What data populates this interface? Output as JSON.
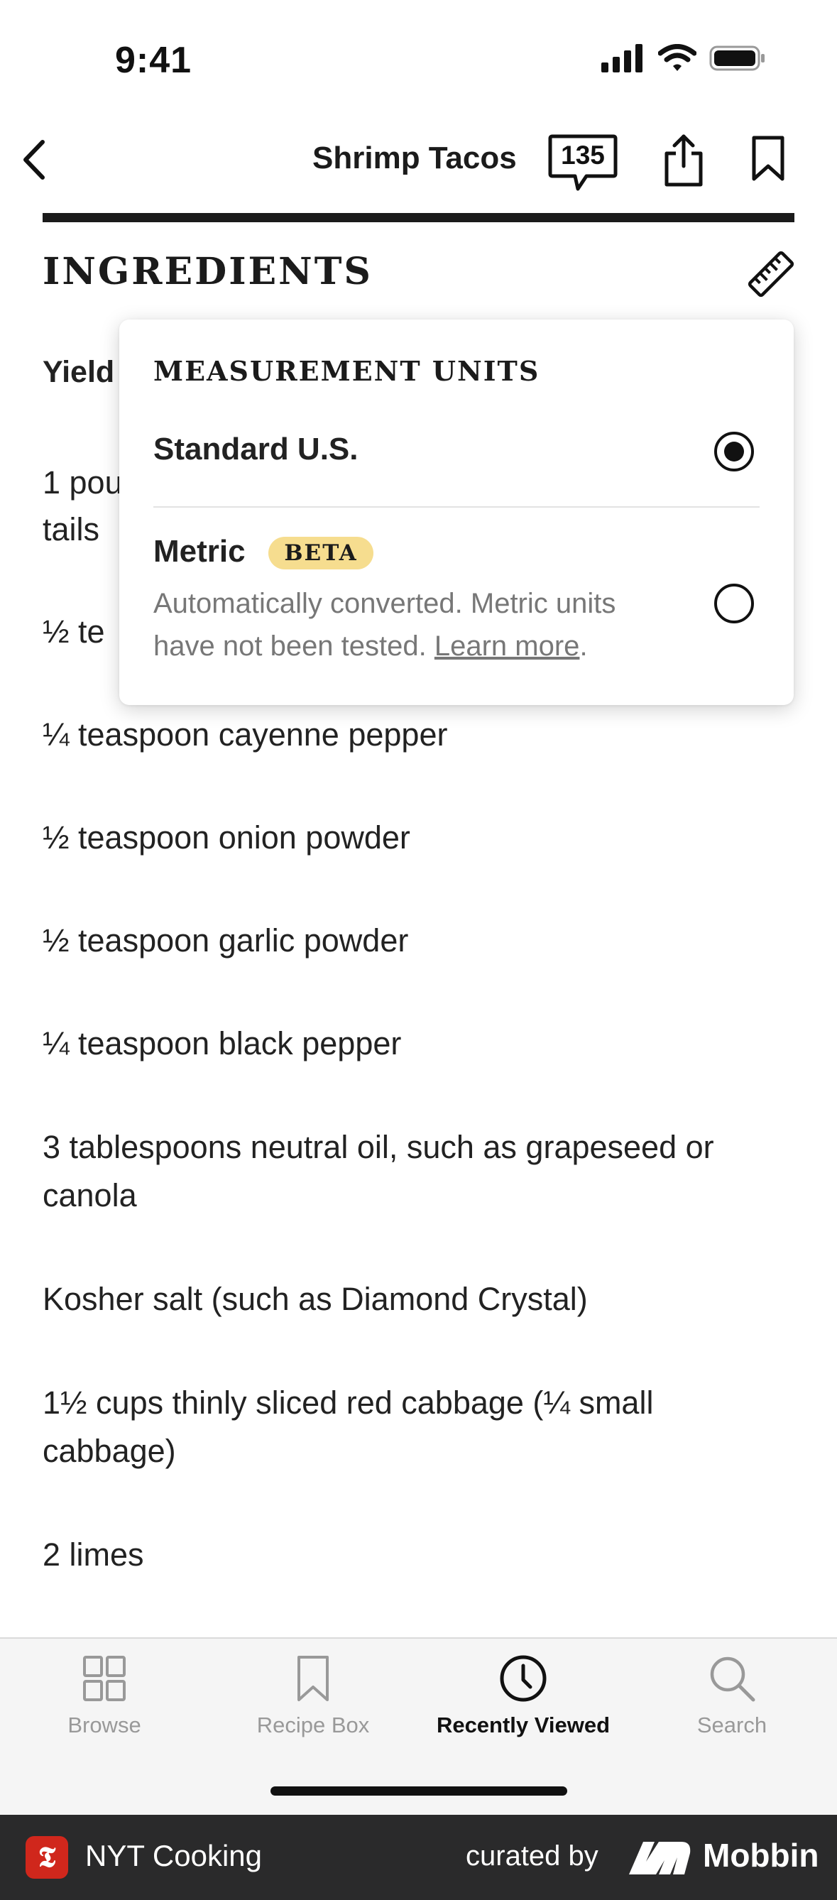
{
  "status_bar": {
    "time": "9:41"
  },
  "nav": {
    "title": "Shrimp Tacos",
    "comment_count": "135"
  },
  "ingredients": {
    "heading": "INGREDIENTS",
    "yield_label": "Yield",
    "visible_partial": [
      "1 pou",
      "tails",
      "½ te"
    ],
    "items": [
      "¼ teaspoon cayenne pepper",
      "½ teaspoon onion powder",
      "½ teaspoon garlic powder",
      "¼ teaspoon black pepper",
      "3 tablespoons neutral oil, such as grapeseed or canola",
      "Kosher salt (such as Diamond Crystal)",
      "1½ cups thinly sliced red cabbage (¼ small cabbage)",
      "2 limes"
    ]
  },
  "popup": {
    "title": "MEASUREMENT UNITS",
    "options": [
      {
        "label": "Standard U.S.",
        "selected": true
      },
      {
        "label": "Metric",
        "badge": "BETA",
        "selected": false
      }
    ],
    "metric_desc": "Automatically converted. Metric units have not been tested.",
    "learn_more": "Learn more",
    "period": "."
  },
  "tabbar": {
    "tabs": [
      {
        "label": "Browse",
        "icon": "grid-icon",
        "active": false
      },
      {
        "label": "Recipe Box",
        "icon": "bookmark-icon",
        "active": false
      },
      {
        "label": "Recently Viewed",
        "icon": "clock-icon",
        "active": true
      },
      {
        "label": "Search",
        "icon": "search-icon",
        "active": false
      }
    ]
  },
  "footer": {
    "app_name": "NYT Cooking",
    "curated_by": "curated by",
    "brand": "Mobbin"
  },
  "colors": {
    "beta_badge": "#f6dd8f",
    "footer_bg": "#2a2a2b",
    "nyt_red": "#d0271c"
  }
}
